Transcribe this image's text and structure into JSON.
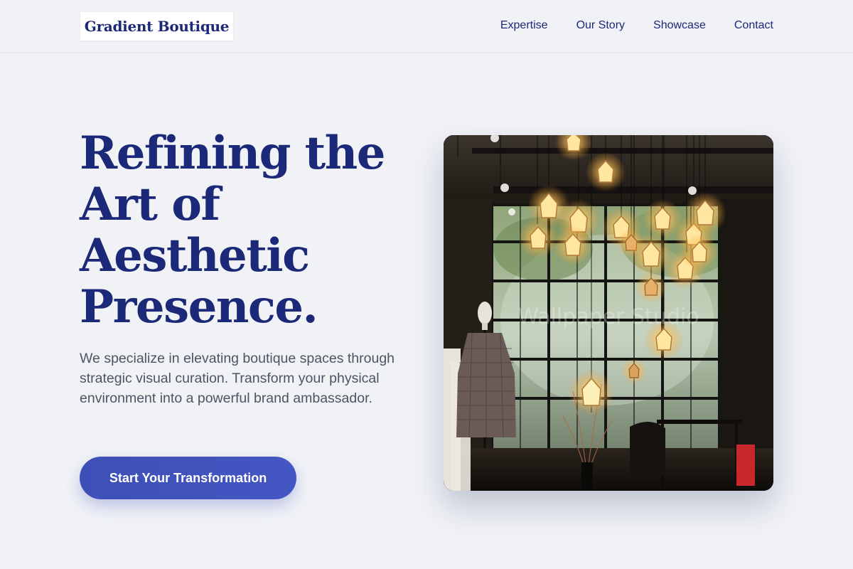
{
  "header": {
    "logo_text": "Gradient Boutique",
    "nav": [
      {
        "label": "Expertise"
      },
      {
        "label": "Our Story"
      },
      {
        "label": "Showcase"
      },
      {
        "label": "Contact"
      }
    ]
  },
  "hero": {
    "title_lines": [
      "Refining the",
      "Art of",
      "Aesthetic",
      "Presence."
    ],
    "description": "We specialize in elevating boutique spaces through strategic visual curation. Transform your physical environment into a powerful brand ambassador.",
    "cta_label": "Start Your Transformation",
    "image_watermark": "Wallpaper Studio"
  },
  "colors": {
    "page_background": "#f0f2f6",
    "brand_navy": "#1c2878",
    "body_text": "#4b5563",
    "cta_gradient_start": "#3f4fb8",
    "cta_gradient_end": "#4456c2"
  }
}
